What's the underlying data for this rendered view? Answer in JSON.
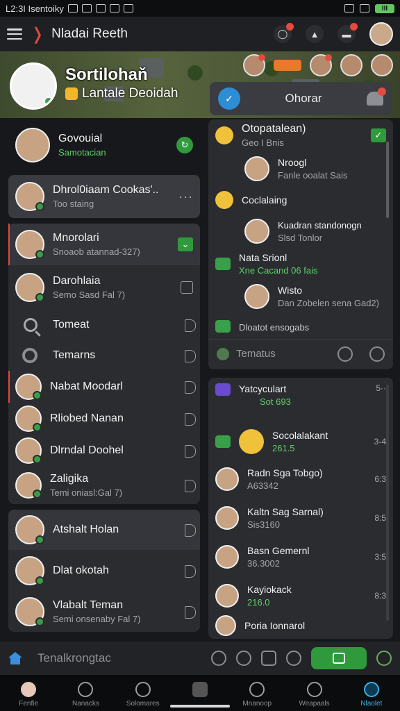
{
  "status_bar": {
    "time": "L2:3I Isentoiky",
    "battery": "III"
  },
  "app_bar": {
    "title": "Nladai Reeth"
  },
  "profile": {
    "name": "Sortilohaň",
    "subtitle": "Lantale Deoidah"
  },
  "banner_pill": "",
  "left_top": {
    "name": "Govouial",
    "status": "Samotacian"
  },
  "pinned": {
    "name": "Dhrol0iaam Cookas'..",
    "status": "Too staing"
  },
  "chats": [
    {
      "name": "Mnorolari",
      "status": "Snoaob atannad-327)",
      "selected": true,
      "tail": "check"
    },
    {
      "name": "Darohlaia",
      "status": "Semo Sasd Fal 7)",
      "tail": "square"
    },
    {
      "name": "Tomeat",
      "status": "",
      "icon": "search",
      "tail": "play"
    },
    {
      "name": "Temarns",
      "status": "",
      "icon": "ring",
      "tail": "play"
    },
    {
      "name": "Nabat Moodarl",
      "status": "",
      "tail": "play"
    },
    {
      "name": "Rliobed Nanan",
      "status": "",
      "tail": "play"
    },
    {
      "name": "Dlrndal Doohel",
      "status": "",
      "tail": "play"
    },
    {
      "name": "Zaligika",
      "status": "Temi oniasl:Gal 7)",
      "tail": "play"
    }
  ],
  "lower_chats": [
    {
      "name": "Atshalt Holan",
      "status": ""
    },
    {
      "name": "Dlat okotah",
      "status": ""
    },
    {
      "name": "Vlabalt Teman",
      "status": "Semi onsenaby Fal 7)"
    }
  ],
  "right_header": {
    "title": "Ohorar"
  },
  "feed": [
    {
      "name": "Otopatalean)",
      "sub": "Geo I Bnis",
      "kind": "emoji"
    },
    {
      "name": "Nroogl",
      "sub": "Fanle ooalat Sais",
      "kind": "avatar"
    },
    {
      "name": "Coclalaing",
      "sub": "",
      "kind": "emoji"
    },
    {
      "name": "Kuadran standonogn",
      "sub": "Slsd Tonlor",
      "kind": "avatar"
    },
    {
      "name": "Nata Srionl",
      "sub": "Xne Cacand   06 fais",
      "kind": "green"
    },
    {
      "name": "Wisto",
      "sub": "Dan  Zobelen sena Gad2)",
      "kind": "avatar"
    },
    {
      "name": "Dloatot ensogabs",
      "sub": "",
      "kind": "green"
    }
  ],
  "feed_footer": {
    "label": "Tematus"
  },
  "lower_feed": [
    {
      "name": "Yatcyculart",
      "sub": "Sot 693",
      "time": "5··"
    },
    {
      "name": "Socolalakant",
      "sub": "261.5",
      "time": "3-4"
    },
    {
      "name": "Radn Sga Tobgo)",
      "sub": "A63342",
      "time": "6:3"
    },
    {
      "name": "Kaltn Sag Sarnal)",
      "sub": "Sis3160",
      "time": "8:5"
    },
    {
      "name": "Basn Gemernl",
      "sub": "36.3002",
      "time": "3:5"
    },
    {
      "name": "Kayiokack",
      "sub": "216.0",
      "time": "8:3"
    },
    {
      "name": "Poria Ionnarol",
      "sub": "",
      "time": ""
    }
  ],
  "bottom_input": {
    "placeholder": "Tenalkrongtac"
  },
  "nav": [
    {
      "label": "Fenfie"
    },
    {
      "label": "Nanacks"
    },
    {
      "label": "Solomares"
    },
    {
      "label": ""
    },
    {
      "label": "Mnanoop"
    },
    {
      "label": "Weapaals"
    },
    {
      "label": "Nlaolet",
      "active": true
    }
  ],
  "colors": {
    "accent_green": "#2f9a3c",
    "accent_red": "#e34b3f",
    "accent_blue": "#3ab0e8"
  }
}
